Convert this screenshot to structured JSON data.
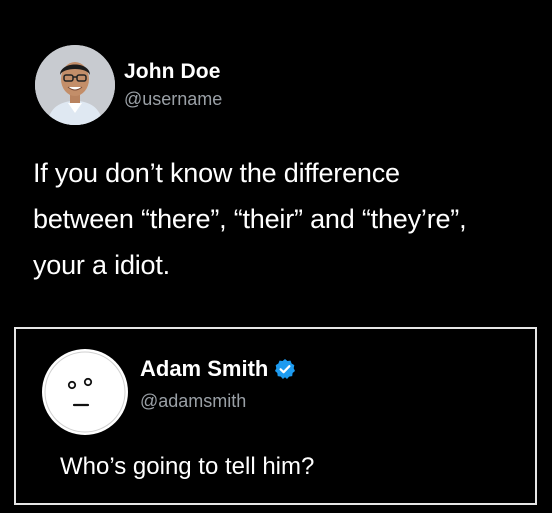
{
  "tweet": {
    "author_name": "John Doe",
    "author_handle": "@username",
    "text": "If you don’t know the difference\nbetween “there”, “their” and “they’re”,\nyour a idiot."
  },
  "reply": {
    "author_name": "Adam Smith",
    "author_handle": "@adamsmith",
    "text": "Who’s going to tell him?",
    "verified": true
  },
  "colors": {
    "background": "#000000",
    "text": "#ffffff",
    "secondary_text": "#9aa0a6",
    "verified_badge": "#1d9bf0",
    "card_border": "#e6e6e6"
  },
  "icons": {
    "main_avatar": "profile-photo",
    "reply_avatar": "neutral-face-icon",
    "badge": "verified-badge-icon"
  }
}
